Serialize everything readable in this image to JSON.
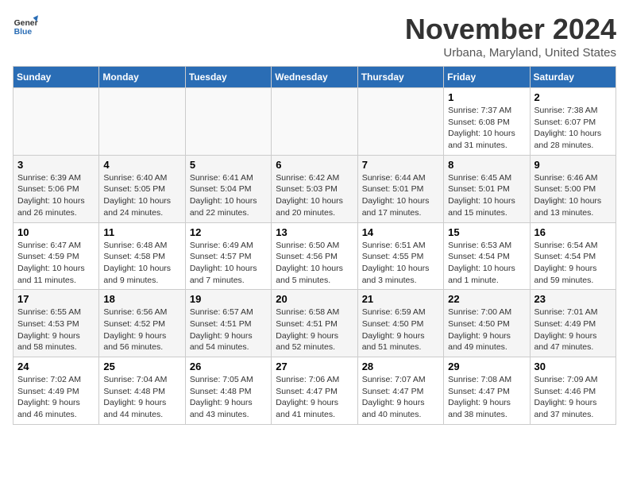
{
  "header": {
    "logo_general": "General",
    "logo_blue": "Blue",
    "month_title": "November 2024",
    "location": "Urbana, Maryland, United States"
  },
  "weekdays": [
    "Sunday",
    "Monday",
    "Tuesday",
    "Wednesday",
    "Thursday",
    "Friday",
    "Saturday"
  ],
  "weeks": [
    [
      {
        "day": "",
        "info": ""
      },
      {
        "day": "",
        "info": ""
      },
      {
        "day": "",
        "info": ""
      },
      {
        "day": "",
        "info": ""
      },
      {
        "day": "",
        "info": ""
      },
      {
        "day": "1",
        "info": "Sunrise: 7:37 AM\nSunset: 6:08 PM\nDaylight: 10 hours and 31 minutes."
      },
      {
        "day": "2",
        "info": "Sunrise: 7:38 AM\nSunset: 6:07 PM\nDaylight: 10 hours and 28 minutes."
      }
    ],
    [
      {
        "day": "3",
        "info": "Sunrise: 6:39 AM\nSunset: 5:06 PM\nDaylight: 10 hours and 26 minutes."
      },
      {
        "day": "4",
        "info": "Sunrise: 6:40 AM\nSunset: 5:05 PM\nDaylight: 10 hours and 24 minutes."
      },
      {
        "day": "5",
        "info": "Sunrise: 6:41 AM\nSunset: 5:04 PM\nDaylight: 10 hours and 22 minutes."
      },
      {
        "day": "6",
        "info": "Sunrise: 6:42 AM\nSunset: 5:03 PM\nDaylight: 10 hours and 20 minutes."
      },
      {
        "day": "7",
        "info": "Sunrise: 6:44 AM\nSunset: 5:01 PM\nDaylight: 10 hours and 17 minutes."
      },
      {
        "day": "8",
        "info": "Sunrise: 6:45 AM\nSunset: 5:01 PM\nDaylight: 10 hours and 15 minutes."
      },
      {
        "day": "9",
        "info": "Sunrise: 6:46 AM\nSunset: 5:00 PM\nDaylight: 10 hours and 13 minutes."
      }
    ],
    [
      {
        "day": "10",
        "info": "Sunrise: 6:47 AM\nSunset: 4:59 PM\nDaylight: 10 hours and 11 minutes."
      },
      {
        "day": "11",
        "info": "Sunrise: 6:48 AM\nSunset: 4:58 PM\nDaylight: 10 hours and 9 minutes."
      },
      {
        "day": "12",
        "info": "Sunrise: 6:49 AM\nSunset: 4:57 PM\nDaylight: 10 hours and 7 minutes."
      },
      {
        "day": "13",
        "info": "Sunrise: 6:50 AM\nSunset: 4:56 PM\nDaylight: 10 hours and 5 minutes."
      },
      {
        "day": "14",
        "info": "Sunrise: 6:51 AM\nSunset: 4:55 PM\nDaylight: 10 hours and 3 minutes."
      },
      {
        "day": "15",
        "info": "Sunrise: 6:53 AM\nSunset: 4:54 PM\nDaylight: 10 hours and 1 minute."
      },
      {
        "day": "16",
        "info": "Sunrise: 6:54 AM\nSunset: 4:54 PM\nDaylight: 9 hours and 59 minutes."
      }
    ],
    [
      {
        "day": "17",
        "info": "Sunrise: 6:55 AM\nSunset: 4:53 PM\nDaylight: 9 hours and 58 minutes."
      },
      {
        "day": "18",
        "info": "Sunrise: 6:56 AM\nSunset: 4:52 PM\nDaylight: 9 hours and 56 minutes."
      },
      {
        "day": "19",
        "info": "Sunrise: 6:57 AM\nSunset: 4:51 PM\nDaylight: 9 hours and 54 minutes."
      },
      {
        "day": "20",
        "info": "Sunrise: 6:58 AM\nSunset: 4:51 PM\nDaylight: 9 hours and 52 minutes."
      },
      {
        "day": "21",
        "info": "Sunrise: 6:59 AM\nSunset: 4:50 PM\nDaylight: 9 hours and 51 minutes."
      },
      {
        "day": "22",
        "info": "Sunrise: 7:00 AM\nSunset: 4:50 PM\nDaylight: 9 hours and 49 minutes."
      },
      {
        "day": "23",
        "info": "Sunrise: 7:01 AM\nSunset: 4:49 PM\nDaylight: 9 hours and 47 minutes."
      }
    ],
    [
      {
        "day": "24",
        "info": "Sunrise: 7:02 AM\nSunset: 4:49 PM\nDaylight: 9 hours and 46 minutes."
      },
      {
        "day": "25",
        "info": "Sunrise: 7:04 AM\nSunset: 4:48 PM\nDaylight: 9 hours and 44 minutes."
      },
      {
        "day": "26",
        "info": "Sunrise: 7:05 AM\nSunset: 4:48 PM\nDaylight: 9 hours and 43 minutes."
      },
      {
        "day": "27",
        "info": "Sunrise: 7:06 AM\nSunset: 4:47 PM\nDaylight: 9 hours and 41 minutes."
      },
      {
        "day": "28",
        "info": "Sunrise: 7:07 AM\nSunset: 4:47 PM\nDaylight: 9 hours and 40 minutes."
      },
      {
        "day": "29",
        "info": "Sunrise: 7:08 AM\nSunset: 4:47 PM\nDaylight: 9 hours and 38 minutes."
      },
      {
        "day": "30",
        "info": "Sunrise: 7:09 AM\nSunset: 4:46 PM\nDaylight: 9 hours and 37 minutes."
      }
    ]
  ]
}
